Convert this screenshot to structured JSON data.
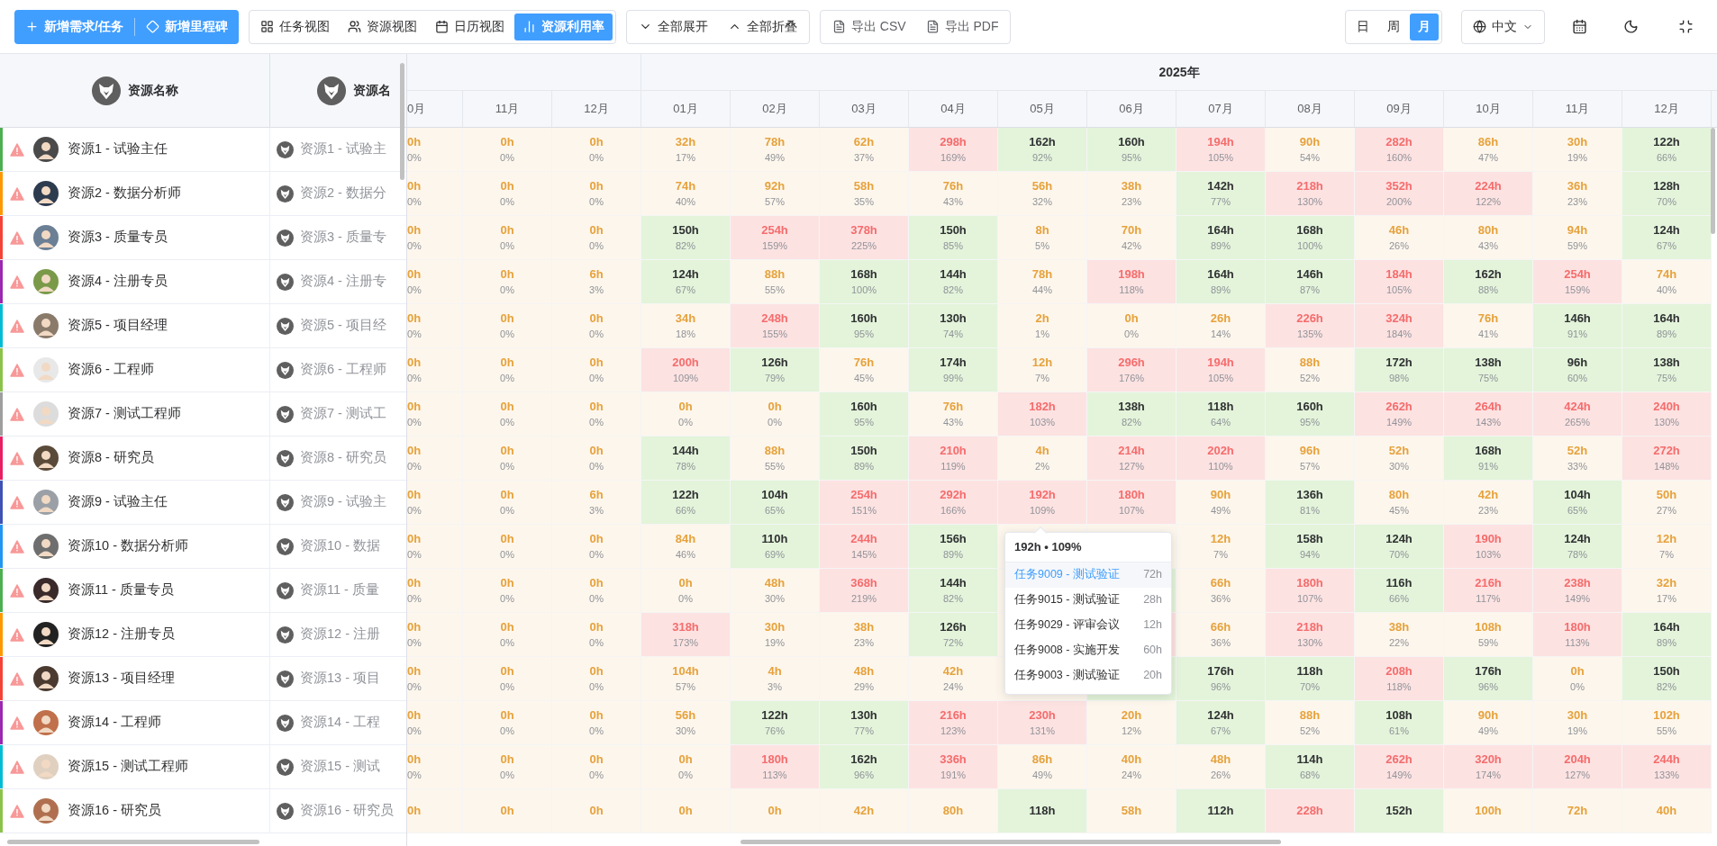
{
  "toolbar": {
    "create_buttons": [
      {
        "label": "新增需求/任务"
      },
      {
        "label": "新增里程碑"
      }
    ],
    "views": [
      {
        "label": "任务视图",
        "selected": false
      },
      {
        "label": "资源视图",
        "selected": false
      },
      {
        "label": "日历视图",
        "selected": false
      },
      {
        "label": "资源利用率",
        "selected": true
      }
    ],
    "expand_buttons": [
      {
        "label": "全部展开"
      },
      {
        "label": "全部折叠"
      }
    ],
    "export_buttons": [
      {
        "label": "导出 CSV"
      },
      {
        "label": "导出 PDF"
      }
    ],
    "scale_tabs": [
      {
        "label": "日",
        "selected": false
      },
      {
        "label": "周",
        "selected": false
      },
      {
        "label": "月",
        "selected": true
      }
    ],
    "language": "中文"
  },
  "resource_table": {
    "header": "资源名称",
    "second_header": "资源名",
    "rows": [
      {
        "name": "资源1 - 试验主任",
        "alias": "资源1 - 试验主",
        "color": "#4caf50",
        "warning": true
      },
      {
        "name": "资源2 - 数据分析师",
        "alias": "资源2 - 数据分",
        "color": "#ff9800",
        "warning": true
      },
      {
        "name": "资源3 - 质量专员",
        "alias": "资源3 - 质量专",
        "color": "#f44336",
        "warning": true
      },
      {
        "name": "资源4 - 注册专员",
        "alias": "资源4 - 注册专",
        "color": "#9c27b0",
        "warning": true
      },
      {
        "name": "资源5 - 项目经理",
        "alias": "资源5 - 项目经",
        "color": "#00bcd4",
        "warning": true
      },
      {
        "name": "资源6 - 工程师",
        "alias": "资源6 - 工程师",
        "color": "#8bc34a",
        "warning": true
      },
      {
        "name": "资源7 - 测试工程师",
        "alias": "资源7 - 测试工",
        "color": "#9e9e9e",
        "warning": true
      },
      {
        "name": "资源8 - 研究员",
        "alias": "资源8 - 研究员",
        "color": "#e91e63",
        "warning": true
      },
      {
        "name": "资源9 - 试验主任",
        "alias": "资源9 - 试验主",
        "color": "#3f51b5",
        "warning": true
      },
      {
        "name": "资源10 - 数据分析师",
        "alias": "资源10 - 数据",
        "color": "#2196f3",
        "warning": true
      },
      {
        "name": "资源11 - 质量专员",
        "alias": "资源11 - 质量",
        "color": "#4caf50",
        "warning": true
      },
      {
        "name": "资源12 - 注册专员",
        "alias": "资源12 - 注册",
        "color": "#ff9800",
        "warning": true
      },
      {
        "name": "资源13 - 项目经理",
        "alias": "资源13 - 项目",
        "color": "#f44336",
        "warning": true
      },
      {
        "name": "资源14 - 工程师",
        "alias": "资源14 - 工程",
        "color": "#9c27b0",
        "warning": true
      },
      {
        "name": "资源15 - 测试工程师",
        "alias": "资源15 - 测试",
        "color": "#00bcd4",
        "warning": true
      },
      {
        "name": "资源16 - 研究员",
        "alias": "资源16 - 研究员",
        "color": "#8bc34a",
        "warning": true
      }
    ]
  },
  "timeline": {
    "year": "2025年",
    "months": [
      "0月",
      "11月",
      "12月",
      "01月",
      "02月",
      "03月",
      "04月",
      "05月",
      "06月",
      "07月",
      "08月",
      "09月",
      "10月",
      "11月",
      "12月"
    ],
    "rows": [
      {
        "cells": [
          {
            "hours": "0h",
            "percent": "0%",
            "kind": "low"
          },
          {
            "hours": "0h",
            "percent": "0%",
            "kind": "low"
          },
          {
            "hours": "0h",
            "percent": "0%",
            "kind": "low"
          },
          {
            "hours": "32h",
            "percent": "17%",
            "kind": "low"
          },
          {
            "hours": "78h",
            "percent": "49%",
            "kind": "low"
          },
          {
            "hours": "62h",
            "percent": "37%",
            "kind": "low"
          },
          {
            "hours": "298h",
            "percent": "169%",
            "kind": "over"
          },
          {
            "hours": "162h",
            "percent": "92%",
            "kind": "ok"
          },
          {
            "hours": "160h",
            "percent": "95%",
            "kind": "ok"
          },
          {
            "hours": "194h",
            "percent": "105%",
            "kind": "over"
          },
          {
            "hours": "90h",
            "percent": "54%",
            "kind": "low"
          },
          {
            "hours": "282h",
            "percent": "160%",
            "kind": "over"
          },
          {
            "hours": "86h",
            "percent": "47%",
            "kind": "low"
          },
          {
            "hours": "30h",
            "percent": "19%",
            "kind": "low"
          },
          {
            "hours": "122h",
            "percent": "66%",
            "kind": "ok"
          }
        ]
      },
      {
        "cells": [
          {
            "hours": "0h",
            "percent": "0%",
            "kind": "low"
          },
          {
            "hours": "0h",
            "percent": "0%",
            "kind": "low"
          },
          {
            "hours": "0h",
            "percent": "0%",
            "kind": "low"
          },
          {
            "hours": "74h",
            "percent": "40%",
            "kind": "low"
          },
          {
            "hours": "92h",
            "percent": "57%",
            "kind": "low"
          },
          {
            "hours": "58h",
            "percent": "35%",
            "kind": "low"
          },
          {
            "hours": "76h",
            "percent": "43%",
            "kind": "low"
          },
          {
            "hours": "56h",
            "percent": "32%",
            "kind": "low"
          },
          {
            "hours": "38h",
            "percent": "23%",
            "kind": "low"
          },
          {
            "hours": "142h",
            "percent": "77%",
            "kind": "ok"
          },
          {
            "hours": "218h",
            "percent": "130%",
            "kind": "over"
          },
          {
            "hours": "352h",
            "percent": "200%",
            "kind": "over"
          },
          {
            "hours": "224h",
            "percent": "122%",
            "kind": "over"
          },
          {
            "hours": "36h",
            "percent": "23%",
            "kind": "low"
          },
          {
            "hours": "128h",
            "percent": "70%",
            "kind": "ok"
          }
        ]
      },
      {
        "cells": [
          {
            "hours": "0h",
            "percent": "0%",
            "kind": "low"
          },
          {
            "hours": "0h",
            "percent": "0%",
            "kind": "low"
          },
          {
            "hours": "0h",
            "percent": "0%",
            "kind": "low"
          },
          {
            "hours": "150h",
            "percent": "82%",
            "kind": "ok"
          },
          {
            "hours": "254h",
            "percent": "159%",
            "kind": "over"
          },
          {
            "hours": "378h",
            "percent": "225%",
            "kind": "over"
          },
          {
            "hours": "150h",
            "percent": "85%",
            "kind": "ok"
          },
          {
            "hours": "8h",
            "percent": "5%",
            "kind": "low"
          },
          {
            "hours": "70h",
            "percent": "42%",
            "kind": "low"
          },
          {
            "hours": "164h",
            "percent": "89%",
            "kind": "ok"
          },
          {
            "hours": "168h",
            "percent": "100%",
            "kind": "ok"
          },
          {
            "hours": "46h",
            "percent": "26%",
            "kind": "low"
          },
          {
            "hours": "80h",
            "percent": "43%",
            "kind": "low"
          },
          {
            "hours": "94h",
            "percent": "59%",
            "kind": "low"
          },
          {
            "hours": "124h",
            "percent": "67%",
            "kind": "ok"
          }
        ]
      },
      {
        "cells": [
          {
            "hours": "0h",
            "percent": "0%",
            "kind": "low"
          },
          {
            "hours": "0h",
            "percent": "0%",
            "kind": "low"
          },
          {
            "hours": "6h",
            "percent": "3%",
            "kind": "low"
          },
          {
            "hours": "124h",
            "percent": "67%",
            "kind": "ok"
          },
          {
            "hours": "88h",
            "percent": "55%",
            "kind": "low"
          },
          {
            "hours": "168h",
            "percent": "100%",
            "kind": "ok"
          },
          {
            "hours": "144h",
            "percent": "82%",
            "kind": "ok"
          },
          {
            "hours": "78h",
            "percent": "44%",
            "kind": "low"
          },
          {
            "hours": "198h",
            "percent": "118%",
            "kind": "over"
          },
          {
            "hours": "164h",
            "percent": "89%",
            "kind": "ok"
          },
          {
            "hours": "146h",
            "percent": "87%",
            "kind": "ok"
          },
          {
            "hours": "184h",
            "percent": "105%",
            "kind": "over"
          },
          {
            "hours": "162h",
            "percent": "88%",
            "kind": "ok"
          },
          {
            "hours": "254h",
            "percent": "159%",
            "kind": "over"
          },
          {
            "hours": "74h",
            "percent": "40%",
            "kind": "low"
          }
        ]
      },
      {
        "cells": [
          {
            "hours": "0h",
            "percent": "0%",
            "kind": "low"
          },
          {
            "hours": "0h",
            "percent": "0%",
            "kind": "low"
          },
          {
            "hours": "0h",
            "percent": "0%",
            "kind": "low"
          },
          {
            "hours": "34h",
            "percent": "18%",
            "kind": "low"
          },
          {
            "hours": "248h",
            "percent": "155%",
            "kind": "over"
          },
          {
            "hours": "160h",
            "percent": "95%",
            "kind": "ok"
          },
          {
            "hours": "130h",
            "percent": "74%",
            "kind": "ok"
          },
          {
            "hours": "2h",
            "percent": "1%",
            "kind": "low"
          },
          {
            "hours": "0h",
            "percent": "0%",
            "kind": "low"
          },
          {
            "hours": "26h",
            "percent": "14%",
            "kind": "low"
          },
          {
            "hours": "226h",
            "percent": "135%",
            "kind": "over"
          },
          {
            "hours": "324h",
            "percent": "184%",
            "kind": "over"
          },
          {
            "hours": "76h",
            "percent": "41%",
            "kind": "low"
          },
          {
            "hours": "146h",
            "percent": "91%",
            "kind": "ok"
          },
          {
            "hours": "164h",
            "percent": "89%",
            "kind": "ok"
          }
        ]
      },
      {
        "cells": [
          {
            "hours": "0h",
            "percent": "0%",
            "kind": "low"
          },
          {
            "hours": "0h",
            "percent": "0%",
            "kind": "low"
          },
          {
            "hours": "0h",
            "percent": "0%",
            "kind": "low"
          },
          {
            "hours": "200h",
            "percent": "109%",
            "kind": "over"
          },
          {
            "hours": "126h",
            "percent": "79%",
            "kind": "ok"
          },
          {
            "hours": "76h",
            "percent": "45%",
            "kind": "low"
          },
          {
            "hours": "174h",
            "percent": "99%",
            "kind": "ok"
          },
          {
            "hours": "12h",
            "percent": "7%",
            "kind": "low"
          },
          {
            "hours": "296h",
            "percent": "176%",
            "kind": "over"
          },
          {
            "hours": "194h",
            "percent": "105%",
            "kind": "over"
          },
          {
            "hours": "88h",
            "percent": "52%",
            "kind": "low"
          },
          {
            "hours": "172h",
            "percent": "98%",
            "kind": "ok"
          },
          {
            "hours": "138h",
            "percent": "75%",
            "kind": "ok"
          },
          {
            "hours": "96h",
            "percent": "60%",
            "kind": "ok"
          },
          {
            "hours": "138h",
            "percent": "75%",
            "kind": "ok"
          }
        ]
      },
      {
        "cells": [
          {
            "hours": "0h",
            "percent": "0%",
            "kind": "low"
          },
          {
            "hours": "0h",
            "percent": "0%",
            "kind": "low"
          },
          {
            "hours": "0h",
            "percent": "0%",
            "kind": "low"
          },
          {
            "hours": "0h",
            "percent": "0%",
            "kind": "low"
          },
          {
            "hours": "0h",
            "percent": "0%",
            "kind": "low"
          },
          {
            "hours": "160h",
            "percent": "95%",
            "kind": "ok"
          },
          {
            "hours": "76h",
            "percent": "43%",
            "kind": "low"
          },
          {
            "hours": "182h",
            "percent": "103%",
            "kind": "over"
          },
          {
            "hours": "138h",
            "percent": "82%",
            "kind": "ok"
          },
          {
            "hours": "118h",
            "percent": "64%",
            "kind": "ok"
          },
          {
            "hours": "160h",
            "percent": "95%",
            "kind": "ok"
          },
          {
            "hours": "262h",
            "percent": "149%",
            "kind": "over"
          },
          {
            "hours": "264h",
            "percent": "143%",
            "kind": "over"
          },
          {
            "hours": "424h",
            "percent": "265%",
            "kind": "over"
          },
          {
            "hours": "240h",
            "percent": "130%",
            "kind": "over"
          }
        ]
      },
      {
        "cells": [
          {
            "hours": "0h",
            "percent": "0%",
            "kind": "low"
          },
          {
            "hours": "0h",
            "percent": "0%",
            "kind": "low"
          },
          {
            "hours": "0h",
            "percent": "0%",
            "kind": "low"
          },
          {
            "hours": "144h",
            "percent": "78%",
            "kind": "ok"
          },
          {
            "hours": "88h",
            "percent": "55%",
            "kind": "low"
          },
          {
            "hours": "150h",
            "percent": "89%",
            "kind": "ok"
          },
          {
            "hours": "210h",
            "percent": "119%",
            "kind": "over"
          },
          {
            "hours": "4h",
            "percent": "2%",
            "kind": "low"
          },
          {
            "hours": "214h",
            "percent": "127%",
            "kind": "over"
          },
          {
            "hours": "202h",
            "percent": "110%",
            "kind": "over"
          },
          {
            "hours": "96h",
            "percent": "57%",
            "kind": "low"
          },
          {
            "hours": "52h",
            "percent": "30%",
            "kind": "low"
          },
          {
            "hours": "168h",
            "percent": "91%",
            "kind": "ok"
          },
          {
            "hours": "52h",
            "percent": "33%",
            "kind": "low"
          },
          {
            "hours": "272h",
            "percent": "148%",
            "kind": "over"
          }
        ]
      },
      {
        "cells": [
          {
            "hours": "0h",
            "percent": "0%",
            "kind": "low"
          },
          {
            "hours": "0h",
            "percent": "0%",
            "kind": "low"
          },
          {
            "hours": "6h",
            "percent": "3%",
            "kind": "low"
          },
          {
            "hours": "122h",
            "percent": "66%",
            "kind": "ok"
          },
          {
            "hours": "104h",
            "percent": "65%",
            "kind": "ok"
          },
          {
            "hours": "254h",
            "percent": "151%",
            "kind": "over"
          },
          {
            "hours": "292h",
            "percent": "166%",
            "kind": "over"
          },
          {
            "hours": "192h",
            "percent": "109%",
            "kind": "over"
          },
          {
            "hours": "180h",
            "percent": "107%",
            "kind": "over"
          },
          {
            "hours": "90h",
            "percent": "49%",
            "kind": "low"
          },
          {
            "hours": "136h",
            "percent": "81%",
            "kind": "ok"
          },
          {
            "hours": "80h",
            "percent": "45%",
            "kind": "low"
          },
          {
            "hours": "42h",
            "percent": "23%",
            "kind": "low"
          },
          {
            "hours": "104h",
            "percent": "65%",
            "kind": "ok"
          },
          {
            "hours": "50h",
            "percent": "27%",
            "kind": "low"
          }
        ]
      },
      {
        "cells": [
          {
            "hours": "0h",
            "percent": "0%",
            "kind": "low"
          },
          {
            "hours": "0h",
            "percent": "0%",
            "kind": "low"
          },
          {
            "hours": "0h",
            "percent": "0%",
            "kind": "low"
          },
          {
            "hours": "84h",
            "percent": "46%",
            "kind": "low"
          },
          {
            "hours": "110h",
            "percent": "69%",
            "kind": "ok"
          },
          {
            "hours": "244h",
            "percent": "145%",
            "kind": "over"
          },
          {
            "hours": "156h",
            "percent": "89%",
            "kind": "ok"
          },
          {
            "kind": "low"
          },
          {
            "kind": "low"
          },
          {
            "hours": "12h",
            "percent": "7%",
            "kind": "low"
          },
          {
            "hours": "158h",
            "percent": "94%",
            "kind": "ok"
          },
          {
            "hours": "124h",
            "percent": "70%",
            "kind": "ok"
          },
          {
            "hours": "190h",
            "percent": "103%",
            "kind": "over"
          },
          {
            "hours": "124h",
            "percent": "78%",
            "kind": "ok"
          },
          {
            "hours": "12h",
            "percent": "7%",
            "kind": "low"
          }
        ]
      },
      {
        "cells": [
          {
            "hours": "0h",
            "percent": "0%",
            "kind": "low"
          },
          {
            "hours": "0h",
            "percent": "0%",
            "kind": "low"
          },
          {
            "hours": "0h",
            "percent": "0%",
            "kind": "low"
          },
          {
            "hours": "0h",
            "percent": "0%",
            "kind": "low"
          },
          {
            "hours": "48h",
            "percent": "30%",
            "kind": "low"
          },
          {
            "hours": "368h",
            "percent": "219%",
            "kind": "over"
          },
          {
            "hours": "144h",
            "percent": "82%",
            "kind": "ok"
          },
          {
            "kind": "low"
          },
          {
            "kind": "ok"
          },
          {
            "hours": "66h",
            "percent": "36%",
            "kind": "low"
          },
          {
            "hours": "180h",
            "percent": "107%",
            "kind": "over"
          },
          {
            "hours": "116h",
            "percent": "66%",
            "kind": "ok"
          },
          {
            "hours": "216h",
            "percent": "117%",
            "kind": "over"
          },
          {
            "hours": "238h",
            "percent": "149%",
            "kind": "over"
          },
          {
            "hours": "32h",
            "percent": "17%",
            "kind": "low"
          }
        ]
      },
      {
        "cells": [
          {
            "hours": "0h",
            "percent": "0%",
            "kind": "low"
          },
          {
            "hours": "0h",
            "percent": "0%",
            "kind": "low"
          },
          {
            "hours": "0h",
            "percent": "0%",
            "kind": "low"
          },
          {
            "hours": "318h",
            "percent": "173%",
            "kind": "over"
          },
          {
            "hours": "30h",
            "percent": "19%",
            "kind": "low"
          },
          {
            "hours": "38h",
            "percent": "23%",
            "kind": "low"
          },
          {
            "hours": "126h",
            "percent": "72%",
            "kind": "ok"
          },
          {
            "kind": "low"
          },
          {
            "kind": "over"
          },
          {
            "hours": "66h",
            "percent": "36%",
            "kind": "low"
          },
          {
            "hours": "218h",
            "percent": "130%",
            "kind": "over"
          },
          {
            "hours": "38h",
            "percent": "22%",
            "kind": "low"
          },
          {
            "hours": "108h",
            "percent": "59%",
            "kind": "low"
          },
          {
            "hours": "180h",
            "percent": "113%",
            "kind": "over"
          },
          {
            "hours": "164h",
            "percent": "89%",
            "kind": "ok"
          }
        ]
      },
      {
        "cells": [
          {
            "hours": "0h",
            "percent": "0%",
            "kind": "low"
          },
          {
            "hours": "0h",
            "percent": "0%",
            "kind": "low"
          },
          {
            "hours": "0h",
            "percent": "0%",
            "kind": "low"
          },
          {
            "hours": "104h",
            "percent": "57%",
            "kind": "low"
          },
          {
            "hours": "4h",
            "percent": "3%",
            "kind": "low"
          },
          {
            "hours": "48h",
            "percent": "29%",
            "kind": "low"
          },
          {
            "hours": "42h",
            "percent": "24%",
            "kind": "low"
          },
          {
            "kind": "low"
          },
          {
            "kind": "ok"
          },
          {
            "hours": "176h",
            "percent": "96%",
            "kind": "ok"
          },
          {
            "hours": "118h",
            "percent": "70%",
            "kind": "ok"
          },
          {
            "hours": "208h",
            "percent": "118%",
            "kind": "over"
          },
          {
            "hours": "176h",
            "percent": "96%",
            "kind": "ok"
          },
          {
            "hours": "0h",
            "percent": "0%",
            "kind": "low"
          },
          {
            "hours": "150h",
            "percent": "82%",
            "kind": "ok"
          }
        ]
      },
      {
        "cells": [
          {
            "hours": "0h",
            "percent": "0%",
            "kind": "low"
          },
          {
            "hours": "0h",
            "percent": "0%",
            "kind": "low"
          },
          {
            "hours": "0h",
            "percent": "0%",
            "kind": "low"
          },
          {
            "hours": "56h",
            "percent": "30%",
            "kind": "low"
          },
          {
            "hours": "122h",
            "percent": "76%",
            "kind": "ok"
          },
          {
            "hours": "130h",
            "percent": "77%",
            "kind": "ok"
          },
          {
            "hours": "216h",
            "percent": "123%",
            "kind": "over"
          },
          {
            "hours": "230h",
            "percent": "131%",
            "kind": "over"
          },
          {
            "hours": "20h",
            "percent": "12%",
            "kind": "low"
          },
          {
            "hours": "124h",
            "percent": "67%",
            "kind": "ok"
          },
          {
            "hours": "88h",
            "percent": "52%",
            "kind": "low"
          },
          {
            "hours": "108h",
            "percent": "61%",
            "kind": "ok"
          },
          {
            "hours": "90h",
            "percent": "49%",
            "kind": "low"
          },
          {
            "hours": "30h",
            "percent": "19%",
            "kind": "low"
          },
          {
            "hours": "102h",
            "percent": "55%",
            "kind": "low"
          }
        ]
      },
      {
        "cells": [
          {
            "hours": "0h",
            "percent": "0%",
            "kind": "low"
          },
          {
            "hours": "0h",
            "percent": "0%",
            "kind": "low"
          },
          {
            "hours": "0h",
            "percent": "0%",
            "kind": "low"
          },
          {
            "hours": "0h",
            "percent": "0%",
            "kind": "low"
          },
          {
            "hours": "180h",
            "percent": "113%",
            "kind": "over"
          },
          {
            "hours": "162h",
            "percent": "96%",
            "kind": "ok"
          },
          {
            "hours": "336h",
            "percent": "191%",
            "kind": "over"
          },
          {
            "hours": "86h",
            "percent": "49%",
            "kind": "low"
          },
          {
            "hours": "40h",
            "percent": "24%",
            "kind": "low"
          },
          {
            "hours": "48h",
            "percent": "26%",
            "kind": "low"
          },
          {
            "hours": "114h",
            "percent": "68%",
            "kind": "ok"
          },
          {
            "hours": "262h",
            "percent": "149%",
            "kind": "over"
          },
          {
            "hours": "320h",
            "percent": "174%",
            "kind": "over"
          },
          {
            "hours": "204h",
            "percent": "127%",
            "kind": "over"
          },
          {
            "hours": "244h",
            "percent": "133%",
            "kind": "over"
          }
        ]
      },
      {
        "cells": [
          {
            "hours": "0h",
            "kind": "low"
          },
          {
            "hours": "0h",
            "kind": "low"
          },
          {
            "hours": "0h",
            "kind": "low"
          },
          {
            "hours": "0h",
            "kind": "low"
          },
          {
            "hours": "0h",
            "kind": "low"
          },
          {
            "hours": "42h",
            "kind": "low"
          },
          {
            "hours": "80h",
            "kind": "low"
          },
          {
            "hours": "118h",
            "kind": "ok"
          },
          {
            "hours": "58h",
            "kind": "low"
          },
          {
            "hours": "112h",
            "kind": "ok"
          },
          {
            "hours": "228h",
            "kind": "over"
          },
          {
            "hours": "152h",
            "kind": "ok"
          },
          {
            "hours": "100h",
            "kind": "low"
          },
          {
            "hours": "72h",
            "kind": "low"
          },
          {
            "hours": "40h",
            "kind": "low"
          }
        ]
      }
    ]
  },
  "tooltip": {
    "title": "192h • 109%",
    "items": [
      {
        "task": "任务9009 - 测试验证",
        "hours": "72h",
        "selected": true
      },
      {
        "task": "任务9015 - 测试验证",
        "hours": "28h",
        "selected": false
      },
      {
        "task": "任务9029 - 评审会议",
        "hours": "12h",
        "selected": false
      },
      {
        "task": "任务9008 - 实施开发",
        "hours": "60h",
        "selected": false
      },
      {
        "task": "任务9003 - 测试验证",
        "hours": "20h",
        "selected": false
      }
    ]
  }
}
